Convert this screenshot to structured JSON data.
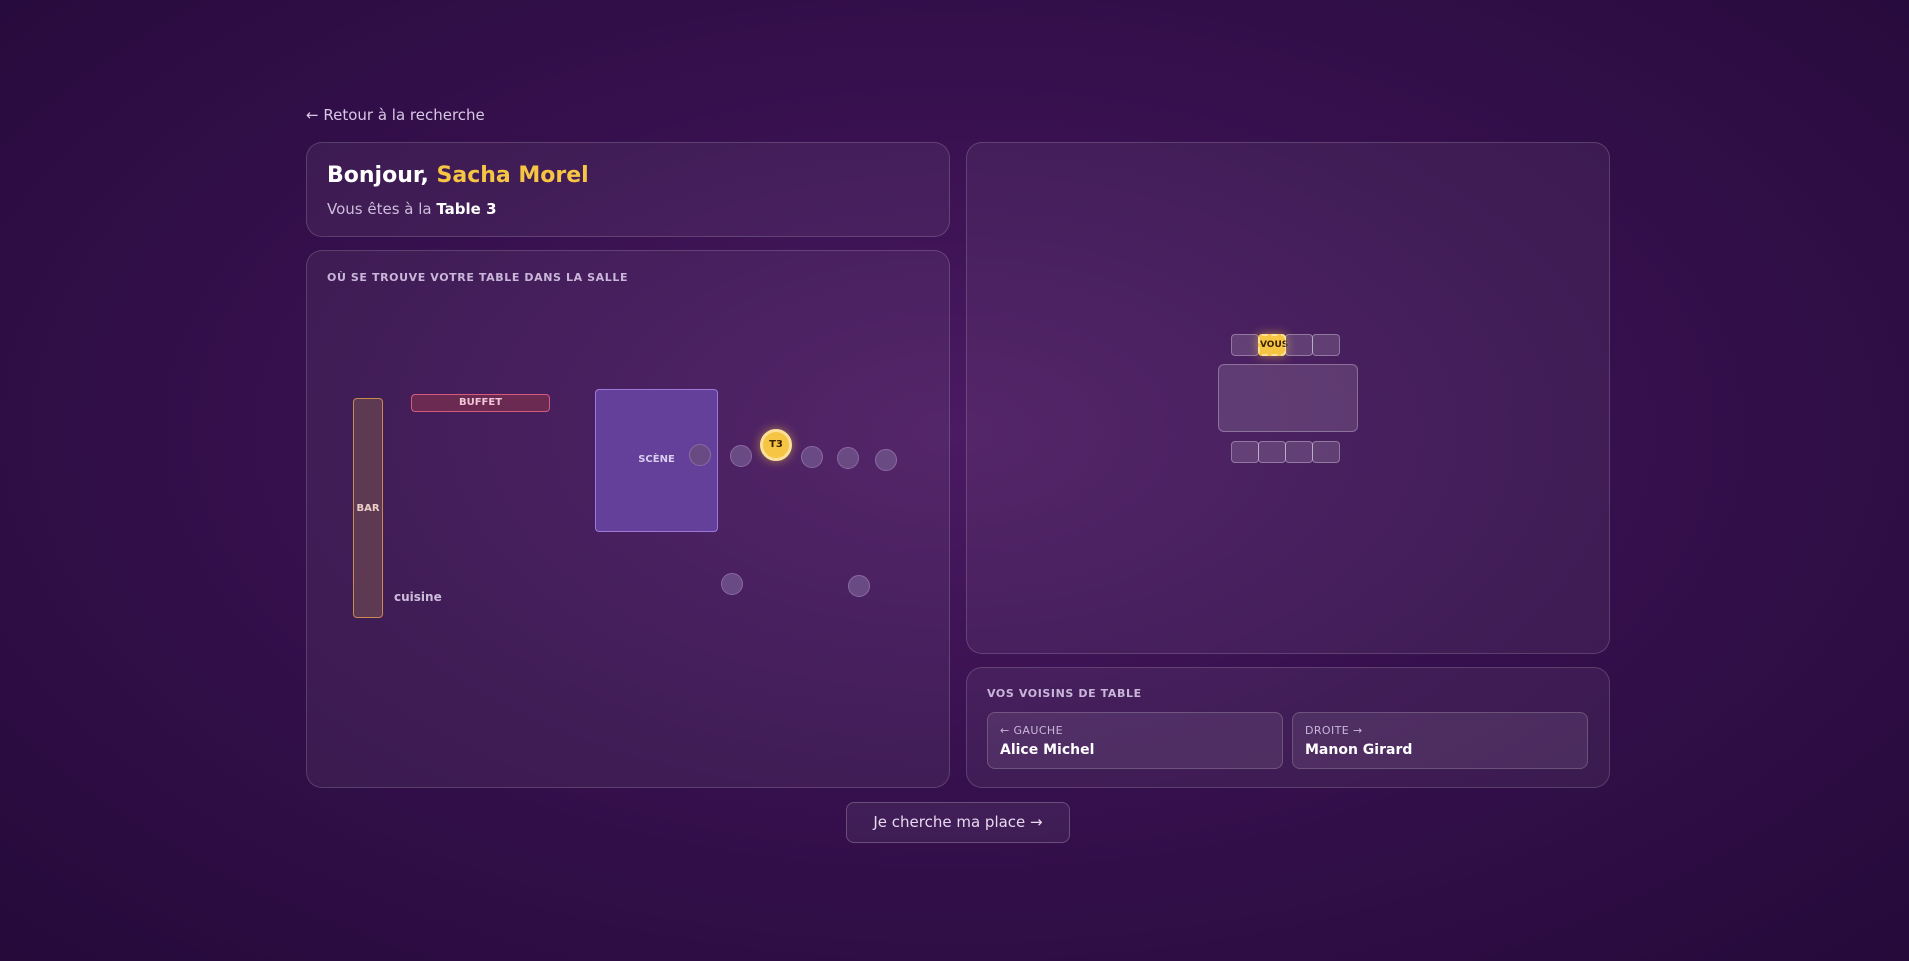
{
  "nav": {
    "back_label": "← Retour à la recherche"
  },
  "greeting": {
    "hello": "Bonjour, ",
    "guest_name": "Sacha Morel",
    "table_prefix": "Vous êtes à la ",
    "table_name": "Table 3"
  },
  "room_map": {
    "title": "OÙ SE TROUVE VOTRE TABLE DANS LA SALLE",
    "bar_label": "BAR",
    "buffet_label": "BUFFET",
    "kitchen_label": "cuisine",
    "stage_label": "SCÈNE",
    "current_table_label": "T3"
  },
  "seating": {
    "you_label": "VOUS"
  },
  "neighbors": {
    "title": "VOS VOISINS DE TABLE",
    "left_label": "← GAUCHE",
    "left_name": "Alice Michel",
    "right_label": "DROITE →",
    "right_name": "Manon Girard"
  },
  "cta": {
    "label": "Je cherche ma place →"
  },
  "colors": {
    "accent": "#f7c544",
    "background": "#37104e",
    "stage": "#65409a",
    "buffet": "#6b2a52",
    "bar": "#5e3a52"
  }
}
